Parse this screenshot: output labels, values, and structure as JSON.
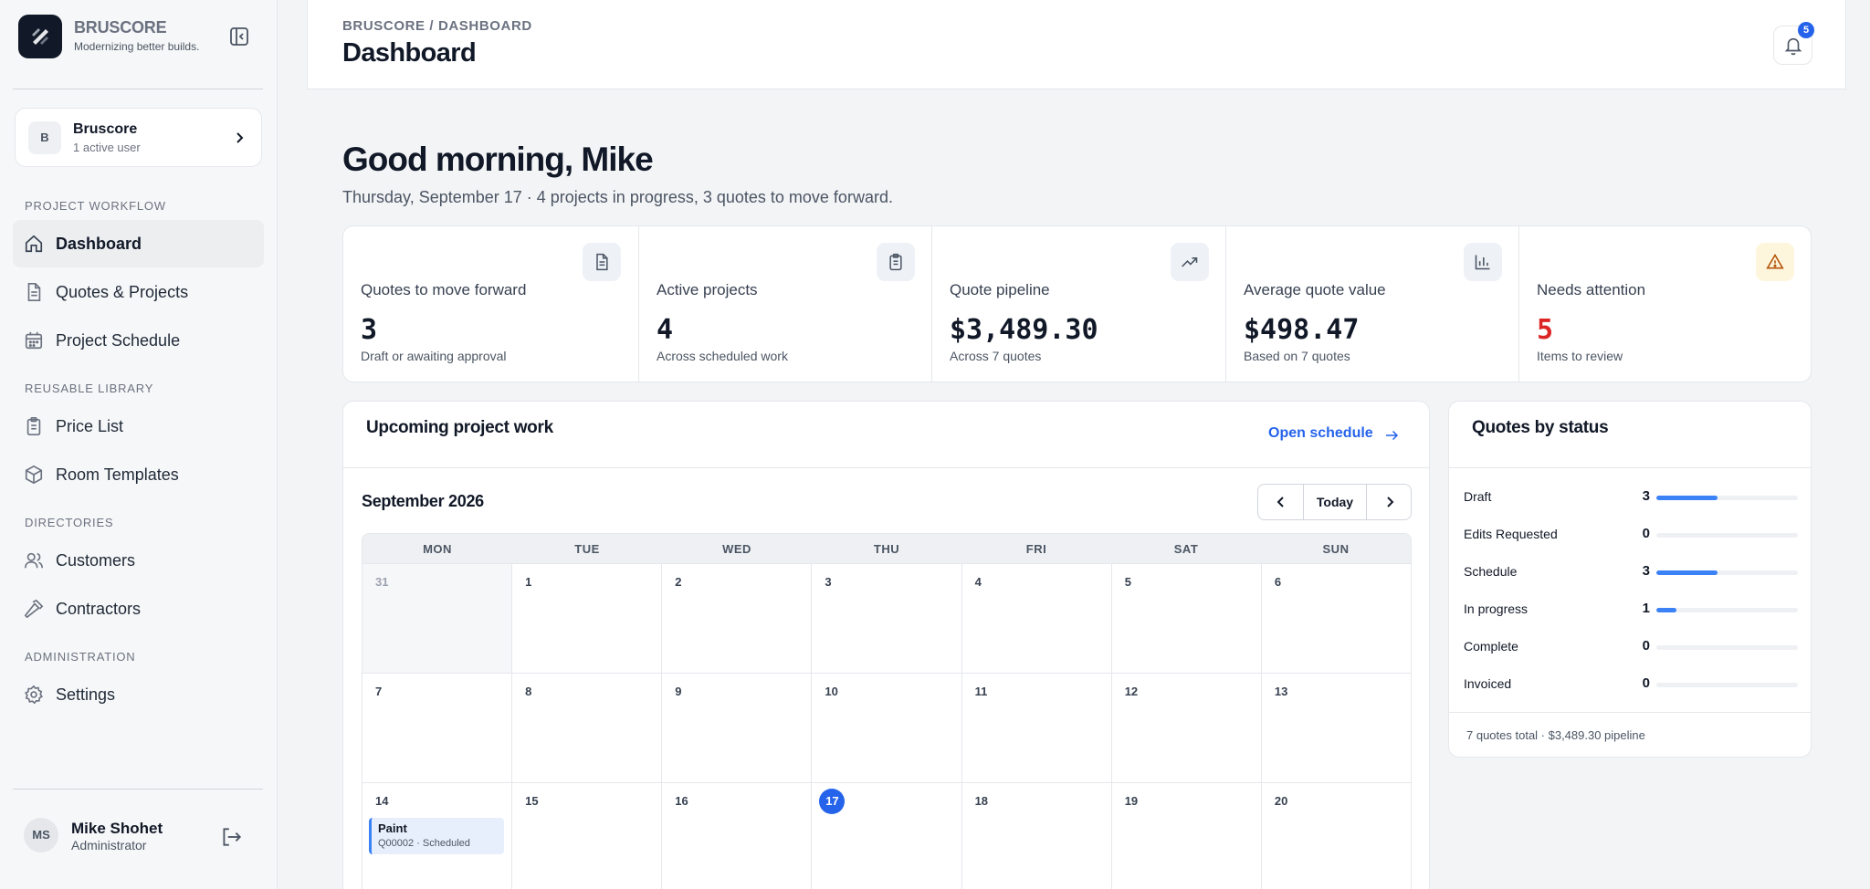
{
  "brand": {
    "name": "BRUSCORE",
    "tagline": "Modernizing better builds."
  },
  "account": {
    "initial": "B",
    "name": "Bruscore",
    "subtitle": "1 active user"
  },
  "sidebar": {
    "sections": [
      "PROJECT WORKFLOW",
      "REUSABLE LIBRARY",
      "DIRECTORIES",
      "ADMINISTRATION"
    ],
    "items": [
      {
        "label": "Dashboard",
        "icon": "home-icon",
        "active": true
      },
      {
        "label": "Quotes & Projects",
        "icon": "document-icon"
      },
      {
        "label": "Project Schedule",
        "icon": "calendar-icon"
      },
      {
        "label": "Price List",
        "icon": "clipboard-icon"
      },
      {
        "label": "Room Templates",
        "icon": "cube-icon"
      },
      {
        "label": "Customers",
        "icon": "users-icon"
      },
      {
        "label": "Contractors",
        "icon": "hammer-icon"
      },
      {
        "label": "Settings",
        "icon": "gear-icon"
      }
    ]
  },
  "user": {
    "initials": "MS",
    "name": "Mike Shohet",
    "role": "Administrator"
  },
  "header": {
    "breadcrumb": "BRUSCORE / DASHBOARD",
    "title": "Dashboard",
    "notification_count": "5"
  },
  "greeting": {
    "title": "Good morning, Mike",
    "subtitle": "Thursday, September 17 · 4 projects in progress, 3 quotes to move forward."
  },
  "stats": [
    {
      "label": "Quotes to move forward",
      "value": "3",
      "sub": "Draft or awaiting approval",
      "icon": "document-icon"
    },
    {
      "label": "Active projects",
      "value": "4",
      "sub": "Across scheduled work",
      "icon": "clipboard-icon"
    },
    {
      "label": "Quote pipeline",
      "value": "$3,489.30",
      "sub": "Across 7 quotes",
      "icon": "trending-up-icon"
    },
    {
      "label": "Average quote value",
      "value": "$498.47",
      "sub": "Based on 7 quotes",
      "icon": "bar-chart-icon"
    },
    {
      "label": "Needs attention",
      "value": "5",
      "sub": "Items to review",
      "icon": "warning-icon",
      "accent": "#dc2626"
    }
  ],
  "schedule": {
    "title": "Upcoming project work",
    "open_link": "Open schedule",
    "month": "September 2026",
    "today_label": "Today",
    "weekdays": [
      "MON",
      "TUE",
      "WED",
      "THU",
      "FRI",
      "SAT",
      "SUN"
    ],
    "weeks": [
      [
        "31",
        "1",
        "2",
        "3",
        "4",
        "5",
        "6"
      ],
      [
        "7",
        "8",
        "9",
        "10",
        "11",
        "12",
        "13"
      ],
      [
        "14",
        "15",
        "16",
        "17",
        "18",
        "19",
        "20"
      ]
    ],
    "today": "17",
    "event": {
      "title": "Paint",
      "subtitle": "Q00002 · Scheduled"
    }
  },
  "quotes_by_status": {
    "title": "Quotes by status",
    "rows": [
      {
        "name": "Draft",
        "count": "3",
        "share": 0.43
      },
      {
        "name": "Edits Requested",
        "count": "0",
        "share": 0
      },
      {
        "name": "Schedule",
        "count": "3",
        "share": 0.43
      },
      {
        "name": "In progress",
        "count": "1",
        "share": 0.14
      },
      {
        "name": "Complete",
        "count": "0",
        "share": 0
      },
      {
        "name": "Invoiced",
        "count": "0",
        "share": 0
      }
    ],
    "footer": "7 quotes total · $3,489.30 pipeline"
  },
  "colors": {
    "accent": "#2563eb",
    "danger": "#dc2626",
    "warning": "#d97706"
  }
}
